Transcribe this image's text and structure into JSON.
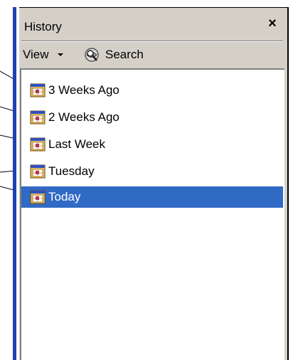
{
  "panel": {
    "title": "History",
    "close_label": "×"
  },
  "toolbar": {
    "view_label": "View",
    "search_label": "Search"
  },
  "history": {
    "items": [
      {
        "label": "3 Weeks Ago",
        "selected": false
      },
      {
        "label": "2 Weeks Ago",
        "selected": false
      },
      {
        "label": "Last Week",
        "selected": false
      },
      {
        "label": "Tuesday",
        "selected": false
      },
      {
        "label": "Today",
        "selected": true
      }
    ]
  },
  "colors": {
    "selection": "#316ac5",
    "panel_edge": "#1f3fb5",
    "panel_bg": "#d4d0c8"
  }
}
